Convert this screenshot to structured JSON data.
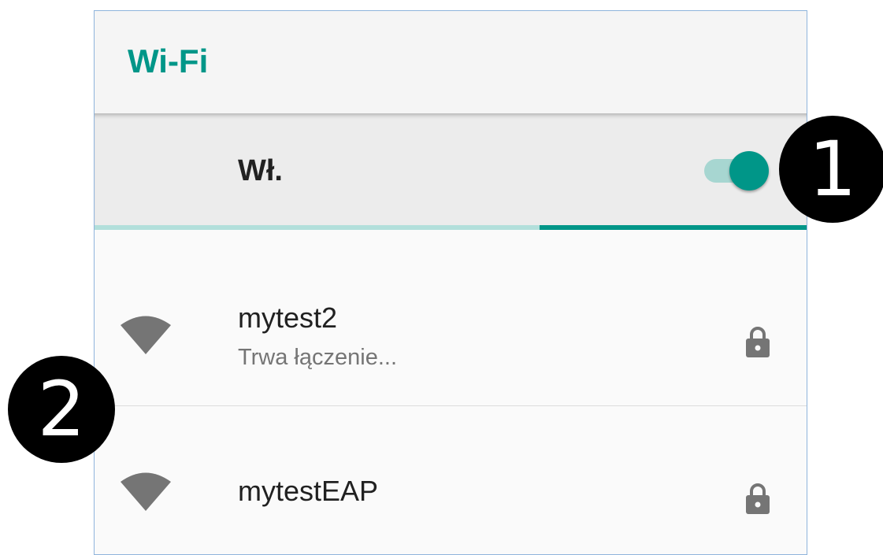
{
  "appbar": {
    "title": "Wi-Fi"
  },
  "master_switch": {
    "label": "Wł.",
    "state": "on"
  },
  "networks": [
    {
      "name": "mytest2",
      "status": "Trwa łączenie...",
      "icon": "wifi-signal-icon",
      "secured_icon": "lock-icon"
    },
    {
      "name": "mytestEAP",
      "status": "",
      "icon": "wifi-signal-icon",
      "secured_icon": "lock-icon"
    }
  ],
  "callouts": [
    {
      "label": "1"
    },
    {
      "label": "2"
    }
  ],
  "colors": {
    "accent": "#009688",
    "accent_light": "#b2dfdb",
    "text_primary": "#212121",
    "text_secondary": "#757575",
    "icon_gray": "#757575"
  }
}
